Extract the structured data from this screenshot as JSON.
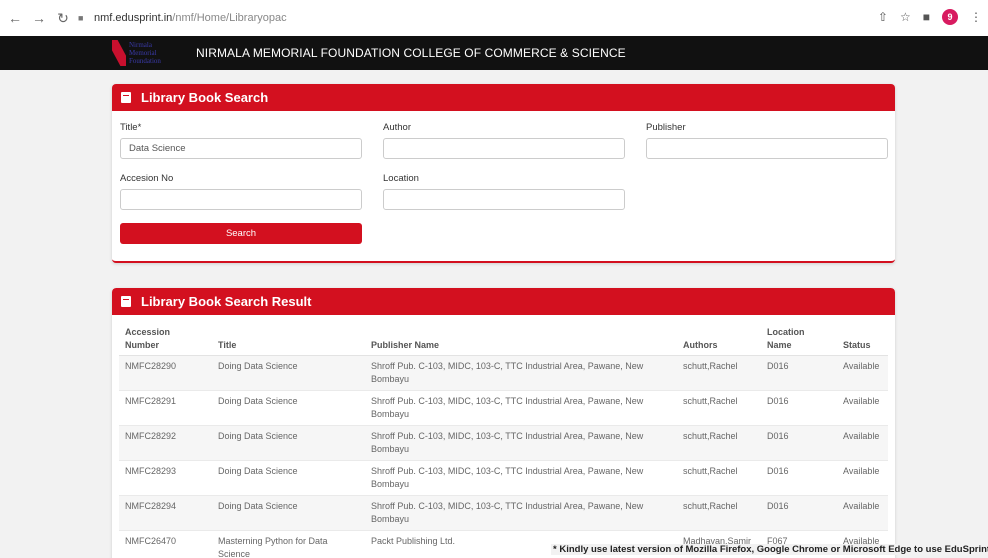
{
  "browser": {
    "url_host": "nmf.edusprint.in",
    "url_path": "/nmf/Home/Libraryopac",
    "profile_initial": "9"
  },
  "header": {
    "logo_lines": [
      "Nirmala",
      "Memorial",
      "Foundation"
    ],
    "title": "NIRMALA MEMORIAL FOUNDATION COLLEGE OF COMMERCE & SCIENCE"
  },
  "search_panel": {
    "heading": "Library Book Search",
    "title_label": "Title*",
    "title_value": "Data Science",
    "author_label": "Author",
    "author_value": "",
    "publisher_label": "Publisher",
    "publisher_value": "",
    "accession_label": "Accesion No",
    "accession_value": "",
    "location_label": "Location",
    "location_value": "",
    "search_button": "Search"
  },
  "result_panel": {
    "heading": "Library Book Search Result",
    "columns": {
      "accession": "Accession Number",
      "title": "Title",
      "publisher": "Publisher Name",
      "authors": "Authors",
      "location": "Location Name",
      "status": "Status"
    },
    "rows": [
      {
        "accession": "NMFC28290",
        "title": "Doing Data Science",
        "publisher": "Shroff Pub. C-103, MIDC, 103-C, TTC Industrial Area, Pawane, New Bombayu",
        "authors": "schutt,Rachel",
        "location": "D016",
        "status": "Available"
      },
      {
        "accession": "NMFC28291",
        "title": "Doing Data Science",
        "publisher": "Shroff Pub. C-103, MIDC, 103-C, TTC Industrial Area, Pawane, New Bombayu",
        "authors": "schutt,Rachel",
        "location": "D016",
        "status": "Available"
      },
      {
        "accession": "NMFC28292",
        "title": "Doing Data Science",
        "publisher": "Shroff Pub. C-103, MIDC, 103-C, TTC Industrial Area, Pawane, New Bombayu",
        "authors": "schutt,Rachel",
        "location": "D016",
        "status": "Available"
      },
      {
        "accession": "NMFC28293",
        "title": "Doing Data Science",
        "publisher": "Shroff Pub. C-103, MIDC, 103-C, TTC Industrial Area, Pawane, New Bombayu",
        "authors": "schutt,Rachel",
        "location": "D016",
        "status": "Available"
      },
      {
        "accession": "NMFC28294",
        "title": "Doing Data Science",
        "publisher": "Shroff Pub. C-103, MIDC, 103-C, TTC Industrial Area, Pawane, New Bombayu",
        "authors": "schutt,Rachel",
        "location": "D016",
        "status": "Available"
      },
      {
        "accession": "NMFC26470",
        "title": "Masterning Python for Data Science",
        "publisher": "Packt Publishing Ltd.",
        "authors": "Madhavan,Samir",
        "location": "F067",
        "status": "Available"
      }
    ]
  },
  "footer": {
    "note": "* Kindly use latest version of Mozilla Firefox, Google Chrome or Microsoft Edge to use EduSprint"
  },
  "colors": {
    "accent": "#d3101f",
    "header_bg": "#111111"
  }
}
